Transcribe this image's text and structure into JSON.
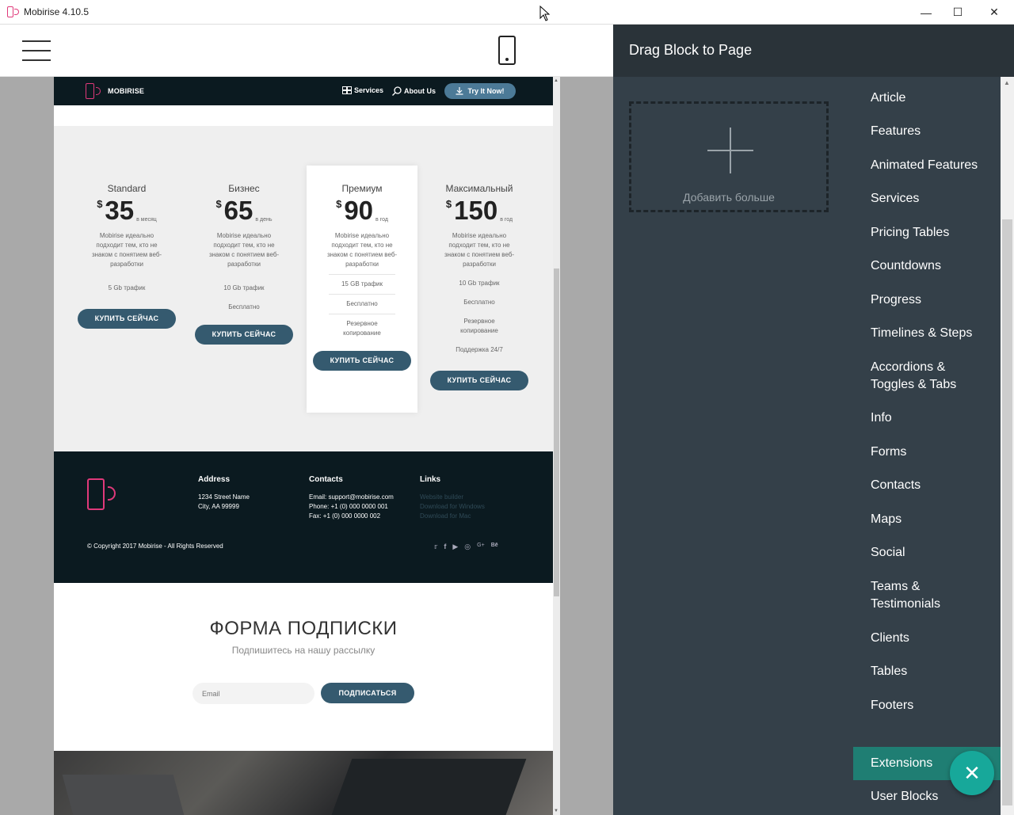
{
  "window": {
    "title": "Mobirise 4.10.5"
  },
  "site": {
    "brand": "MOBIRISE",
    "nav": {
      "services": "Services",
      "about": "About Us",
      "try": "Try It Now!"
    },
    "plans": [
      {
        "name": "Standard",
        "currency": "$",
        "price": "35",
        "period": "в месяц",
        "desc": "Mobirise идеально подходит тем, кто не знаком с понятием веб-разработки",
        "features": [
          "5 Gb трафик"
        ],
        "button": "КУПИТЬ СЕЙЧАС"
      },
      {
        "name": "Бизнес",
        "currency": "$",
        "price": "65",
        "period": "в день",
        "desc": "Mobirise идеально подходит тем, кто не знаком с понятием веб-разработки",
        "features": [
          "10 Gb трафик",
          "Бесплатно"
        ],
        "button": "КУПИТЬ СЕЙЧАС"
      },
      {
        "name": "Премиум",
        "currency": "$",
        "price": "90",
        "period": "в год",
        "desc": "Mobirise идеально подходит тем, кто не знаком с понятием веб-разработки",
        "features": [
          "15 GB трафик",
          "Бесплатно",
          "Резервное копирование"
        ],
        "button": "КУПИТЬ СЕЙЧАС"
      },
      {
        "name": "Максимальный",
        "currency": "$",
        "price": "150",
        "period": "в год",
        "desc": "Mobirise идеально подходит тем, кто не знаком с понятием веб-разработки",
        "features": [
          "10 Gb трафик",
          "Бесплатно",
          "Резервное копирование",
          "Поддержка 24/7"
        ],
        "button": "КУПИТЬ СЕЙЧАС"
      }
    ],
    "footer": {
      "address": {
        "title": "Address",
        "line1": "1234 Street Name",
        "line2": "City, AA 99999"
      },
      "contacts": {
        "title": "Contacts",
        "email": "Email: support@mobirise.com",
        "phone": "Phone: +1 (0) 000 0000 001",
        "fax": "Fax: +1 (0) 000 0000 002"
      },
      "links": {
        "title": "Links",
        "l1": "Website builder",
        "l2": "Download for Windows",
        "l3": "Download for Mac"
      },
      "copyright": "© Copyright 2017 Mobirise - All Rights Reserved",
      "social": [
        "twitter-icon",
        "facebook-icon",
        "youtube-icon",
        "instagram-icon",
        "google-plus-icon",
        "behance-icon"
      ]
    },
    "subscribe": {
      "title": "ФОРМА ПОДПИСКИ",
      "desc": "Подпишитесь на нашу рассылку",
      "placeholder": "Email",
      "button": "ПОДПИСАТЬСЯ"
    }
  },
  "panel": {
    "title": "Drag Block to Page",
    "add_more": "Добавить больше",
    "categories": [
      "Article",
      "Features",
      "Animated Features",
      "Services",
      "Pricing Tables",
      "Countdowns",
      "Progress",
      "Timelines & Steps",
      "Accordions &",
      "Toggles & Tabs",
      "Info",
      "Forms",
      "Contacts",
      "Maps",
      "Social",
      "Teams &",
      "Testimonials",
      "Clients",
      "Tables",
      "Footers",
      "Extensions",
      "User Blocks"
    ],
    "active_category": "Extensions"
  },
  "colors": {
    "accent": "#1f7e73",
    "fab": "#17a89a",
    "button": "#355a6f",
    "brand": "#e0397a",
    "panel_bg": "#344049",
    "footer_bg": "#0b1a20"
  }
}
